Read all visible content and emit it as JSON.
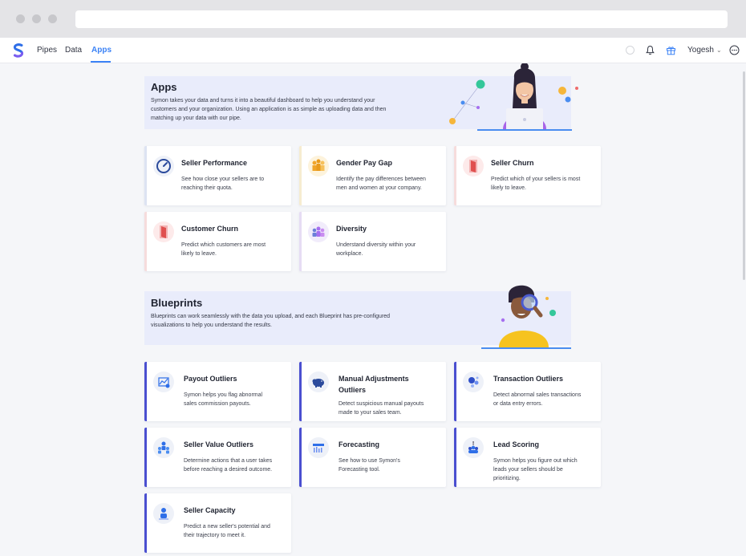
{
  "nav": {
    "links": [
      "Pipes",
      "Data",
      "Apps"
    ],
    "active": "Apps",
    "user_name": "Yogesh",
    "icons": [
      "status-circle-icon",
      "bell-icon",
      "gift-icon",
      "chevron-down-icon",
      "chat-icon"
    ]
  },
  "apps": {
    "title": "Apps",
    "description_lines": [
      "Symon takes your data and turns it into a beautiful dashboard to help you understand your",
      "customers and your organization. Using an application is as simple as uploading data and then",
      "matching up your data with our pipe."
    ],
    "cards": [
      {
        "title_lines": [
          "Seller Performance"
        ],
        "desc_lines": [
          "See how close your sellers are to",
          "reaching their quota."
        ],
        "icon": "gauge-icon",
        "edge_color": "#dde3f2"
      },
      {
        "title_lines": [
          "Gender Pay Gap"
        ],
        "desc_lines": [
          "Identify the pay differences between",
          "men and women at your company."
        ],
        "icon": "people-coins-icon",
        "edge_color": "#f6ecd0"
      },
      {
        "title_lines": [
          "Seller Churn"
        ],
        "desc_lines": [
          "Predict which of your sellers is most",
          "likely to leave."
        ],
        "icon": "exit-door-icon",
        "edge_color": "#f6dcdc"
      },
      {
        "title_lines": [
          "Customer Churn"
        ],
        "desc_lines": [
          "Predict which customers are most",
          "likely to leave."
        ],
        "icon": "exit-door-icon",
        "edge_color": "#f6dcdc"
      },
      {
        "title_lines": [
          "Diversity"
        ],
        "desc_lines": [
          "Understand diversity within your",
          "workplace."
        ],
        "icon": "diverse-people-icon",
        "edge_color": "#e6dcf4"
      }
    ]
  },
  "blueprints": {
    "title": "Blueprints",
    "description_lines": [
      "Blueprints can work seamlessly with the data you upload, and each Blueprint has pre-configured",
      "visualizations to help you understand the results."
    ],
    "cards": [
      {
        "title_lines": [
          "Payout Outliers"
        ],
        "desc_lines": [
          "Symon helps you flag abnormal",
          "sales commission payouts."
        ],
        "icon": "payout-chart-icon"
      },
      {
        "title_lines": [
          "Manual Adjustments",
          "Outliers"
        ],
        "desc_lines": [
          "Detect suspicious manual payouts",
          "made to your sales team."
        ],
        "icon": "piggy-bank-icon"
      },
      {
        "title_lines": [
          "Transaction Outliers"
        ],
        "desc_lines": [
          "Detect abnormal sales transactions",
          "or data entry errors."
        ],
        "icon": "scatter-dots-icon"
      },
      {
        "title_lines": [
          "Seller Value Outliers"
        ],
        "desc_lines": [
          "Determine actions that a user takes",
          "before reaching a desired outcome."
        ],
        "icon": "team-icon"
      },
      {
        "title_lines": [
          "Forecasting"
        ],
        "desc_lines": [
          "See how to use Symon's",
          "Forecasting tool."
        ],
        "icon": "forecast-chart-icon"
      },
      {
        "title_lines": [
          "Lead Scoring"
        ],
        "desc_lines": [
          "Symon helps you figure out which",
          "leads your sellers should be",
          "prioritizing."
        ],
        "icon": "alert-people-icon"
      },
      {
        "title_lines": [
          "Seller Capacity"
        ],
        "desc_lines": [
          "Predict a new seller's potential and",
          "their trajectory to meet it."
        ],
        "icon": "person-chart-icon"
      }
    ]
  },
  "colors": {
    "accent": "#3b82f6",
    "blueprint_edge": "#4a4fd0",
    "banner_bg": "#e9ecfb"
  }
}
